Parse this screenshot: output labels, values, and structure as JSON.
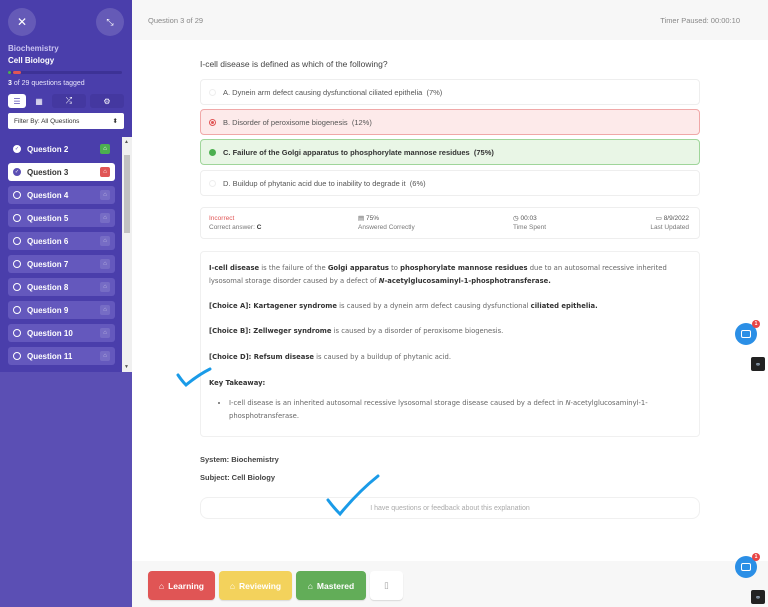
{
  "sidebar": {
    "close_icon": "close-icon",
    "collapse_icon": "collapse-icon",
    "system": "Biochemistry",
    "subject": "Cell Biology",
    "tagged_count": "3",
    "tagged_text": " of 29 questions tagged",
    "view_buttons": [
      "list-view",
      "grid-view",
      "shuffle",
      "settings"
    ],
    "filter": {
      "selected": "Filter By: All Questions"
    },
    "questions": [
      {
        "label": "Question 2",
        "state": "done",
        "tag": "green"
      },
      {
        "label": "Question 3",
        "state": "active",
        "tag": "red"
      },
      {
        "label": "Question 4",
        "state": "open",
        "tag": "none"
      },
      {
        "label": "Question 5",
        "state": "open",
        "tag": "none"
      },
      {
        "label": "Question 6",
        "state": "open",
        "tag": "none"
      },
      {
        "label": "Question 7",
        "state": "open",
        "tag": "none"
      },
      {
        "label": "Question 8",
        "state": "open",
        "tag": "none"
      },
      {
        "label": "Question 9",
        "state": "open",
        "tag": "none"
      },
      {
        "label": "Question 10",
        "state": "open",
        "tag": "none"
      },
      {
        "label": "Question 11",
        "state": "open",
        "tag": "none"
      }
    ]
  },
  "header": {
    "counter": "Question 3 of 29",
    "timer": "Timer Paused: 00:00:10"
  },
  "question": {
    "stem": "I-cell disease is defined as which of the following?",
    "choices": [
      {
        "label": "A. Dynein arm defect causing dysfunctional ciliated epithelia",
        "pct": "(7%)",
        "state": "none"
      },
      {
        "label": "B. Disorder of peroxisome biogenesis",
        "pct": "(12%)",
        "state": "wrong"
      },
      {
        "label": "C. Failure of the Golgi apparatus to phosphorylate mannose residues",
        "pct": "(75%)",
        "state": "right"
      },
      {
        "label": "D. Buildup of phytanic acid due to inability to degrade it",
        "pct": "(6%)",
        "state": "none"
      }
    ]
  },
  "stats": {
    "result": "Incorrect",
    "correct_answer_label": "Correct answer: ",
    "correct_answer": "C",
    "pct_correct": "75%",
    "pct_label": "Answered Correctly",
    "time_spent": "00:03",
    "time_label": "Time Spent",
    "last_updated": "8/9/2022",
    "updated_label": "Last Updated"
  },
  "explanation": {
    "p1": [
      {
        "b": "I-cell disease"
      },
      {
        "t": " is the failure of the "
      },
      {
        "b": "Golgi apparatus"
      },
      {
        "t": " to "
      },
      {
        "b": "phosphorylate mannose residues"
      },
      {
        "t": " due to an autosomal recessive inherited lysosomal storage disorder caused by a defect of "
      },
      {
        "bi": "N"
      },
      {
        "b": "-acetylglucosaminyl-1-phosphotransferase."
      }
    ],
    "p2": [
      {
        "b": "[Choice A]: Kartagener syndrome"
      },
      {
        "t": " is caused by a dynein arm defect causing dysfunctional "
      },
      {
        "b": "ciliated epithelia."
      }
    ],
    "p3": [
      {
        "b": "[Choice B]: Zellweger syndrome"
      },
      {
        "t": " is caused by a disorder of peroxisome biogenesis."
      }
    ],
    "p4": [
      {
        "b": "[Choice D]: Refsum disease"
      },
      {
        "t": " is caused by a buildup of phytanic acid."
      }
    ],
    "takeaway_title": "Key Takeaway:",
    "takeaway": [
      {
        "t": "I-cell disease is an inherited autosomal recessive lysosomal storage disease caused by a defect in "
      },
      {
        "i": "N"
      },
      {
        "t": "-acetylglucosaminyl-1-phosphotransferase."
      }
    ]
  },
  "meta": {
    "system": "System: Biochemistry",
    "subject": "Subject: Cell Biology"
  },
  "feedback": {
    "placeholder": "I have questions or feedback about this explanation"
  },
  "bottom": {
    "learning": "Learning",
    "reviewing": "Reviewing",
    "mastered": "Mastered"
  },
  "chat": {
    "badge": "1"
  },
  "colors": {
    "sidebar": "#5b4fb4",
    "learning": "#e05555",
    "reviewing": "#f3d25c",
    "mastered": "#62ad58",
    "ink": "#1a9be8"
  }
}
